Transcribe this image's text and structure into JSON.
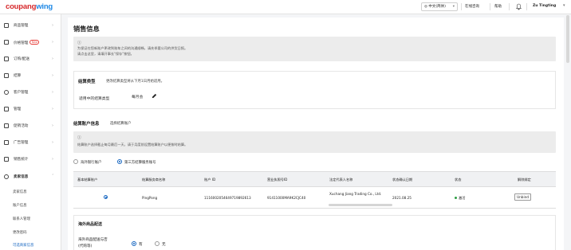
{
  "header": {
    "logo_main": "coupang",
    "logo_sub": "wing",
    "language": "中文(简体)",
    "help_link": "在线咨询",
    "help2_link": "帮助",
    "user_name": "Zu Tingting"
  },
  "sidebar": {
    "items": [
      {
        "label": "商品管理"
      },
      {
        "label": "价格管理",
        "badge": "New"
      },
      {
        "label": "订购/配送"
      },
      {
        "label": "结算"
      },
      {
        "label": "客户管理"
      },
      {
        "label": "管理"
      },
      {
        "label": "促销活动"
      },
      {
        "label": "广告管理"
      },
      {
        "label": "销售统计"
      },
      {
        "label": "卖家信息"
      }
    ],
    "sub_items": [
      {
        "label": "卖家信息"
      },
      {
        "label": "账户信息"
      },
      {
        "label": "联系人管理"
      },
      {
        "label": "更改密码"
      },
      {
        "label": "可选商家信息"
      }
    ]
  },
  "page": {
    "title": "销售信息",
    "notice_line1": "为保证在您新账户更改到账车之间的沟通顺畅，请先季要公司的供货日报。",
    "notice_line2": "请点击这里，请填开事长\"保存\"按钮。"
  },
  "settlement": {
    "heading": "结算类型",
    "note": "更改结算类型将从下月1日月始适用。",
    "current_label": "适用中的结算类型",
    "current_value": "每月会"
  },
  "account": {
    "heading": "结算账户信息",
    "link": "选择结算账户",
    "notice": "结算账户选择截止每月最后一天，请于月度前设置结算账户以便按时结算。",
    "options": [
      {
        "label": "海外银行账户",
        "selected": false
      },
      {
        "label": "第三方结算服务账号",
        "selected": true
      }
    ],
    "columns": [
      "基本结算账户",
      "结算服务商名称",
      "账户 ID",
      "营业执照号ID",
      "法定代表人名称",
      "状态确认日期",
      "状态",
      "解除绑定"
    ],
    "rows": [
      {
        "provider": "PingPong",
        "account_id": "1116002054649719892613",
        "license_id": "91411000MA9K2CJC40",
        "legal_name": "Xuchang Jiang Trading Co., Ltd.",
        "date": "2021.08.25",
        "status": "激活",
        "unbind": "Unbind"
      }
    ]
  },
  "overseas": {
    "heading": "海外商品配送",
    "question_line1": "海外商品配送与否",
    "question_line2": "(代购等)",
    "yes": "有",
    "no": "无"
  },
  "colors": {
    "brand_red": "#d6282b",
    "brand_blue": "#1e88e5",
    "link_blue": "#1565c0",
    "status_green": "#2e9e44"
  }
}
